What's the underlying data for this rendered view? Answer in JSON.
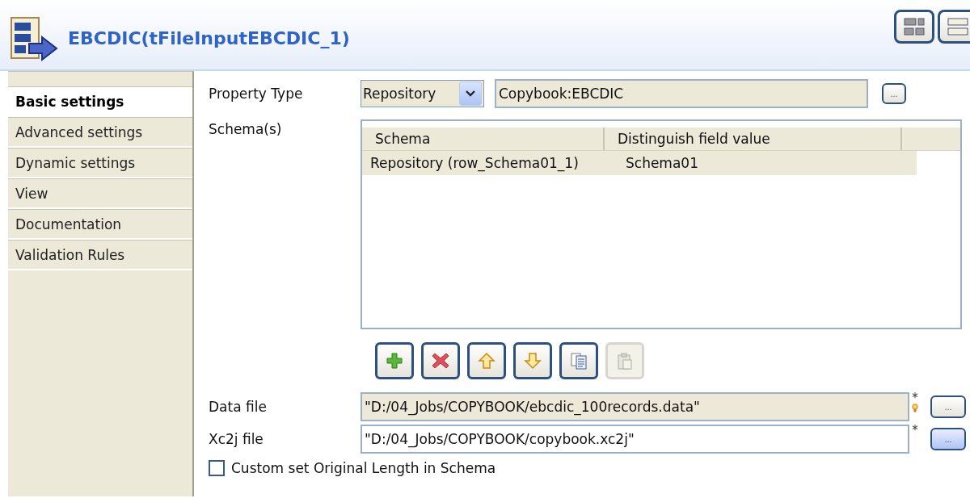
{
  "header": {
    "title": "EBCDIC(tFileInputEBCDIC_1)"
  },
  "tabs": [
    {
      "label": "Basic settings",
      "selected": true
    },
    {
      "label": "Advanced settings",
      "selected": false
    },
    {
      "label": "Dynamic settings",
      "selected": false
    },
    {
      "label": "View",
      "selected": false
    },
    {
      "label": "Documentation",
      "selected": false
    },
    {
      "label": "Validation Rules",
      "selected": false
    }
  ],
  "property_type": {
    "label": "Property Type",
    "value": "Repository",
    "detail": "Copybook:EBCDIC",
    "button": "..."
  },
  "schemas": {
    "label": "Schema(s)",
    "columns": [
      "Schema",
      "Distinguish field value"
    ],
    "rows": [
      {
        "cells": [
          "Repository (row_Schema01_1)",
          "Schema01"
        ],
        "selected": true
      }
    ],
    "tools": [
      {
        "kind": "add",
        "disabled": false
      },
      {
        "kind": "remove",
        "disabled": false
      },
      {
        "kind": "up",
        "disabled": false
      },
      {
        "kind": "down",
        "disabled": false
      },
      {
        "kind": "copy",
        "disabled": false
      },
      {
        "kind": "paste",
        "disabled": true
      }
    ]
  },
  "files": [
    {
      "label": "Data file",
      "value": "\"D:/04_Jobs/COPYBOOK/ebcdic_100records.data\"",
      "readonly": true,
      "marks": "*",
      "hint": true,
      "button": "...",
      "focused": false
    },
    {
      "label": "Xc2j file",
      "value": "\"D:/04_Jobs/COPYBOOK/copybook.xc2j\"",
      "readonly": false,
      "marks": "*",
      "hint": false,
      "button": "...",
      "focused": true
    }
  ],
  "custom_length": {
    "label": "Custom set Original Length in Schema",
    "checked": false
  }
}
